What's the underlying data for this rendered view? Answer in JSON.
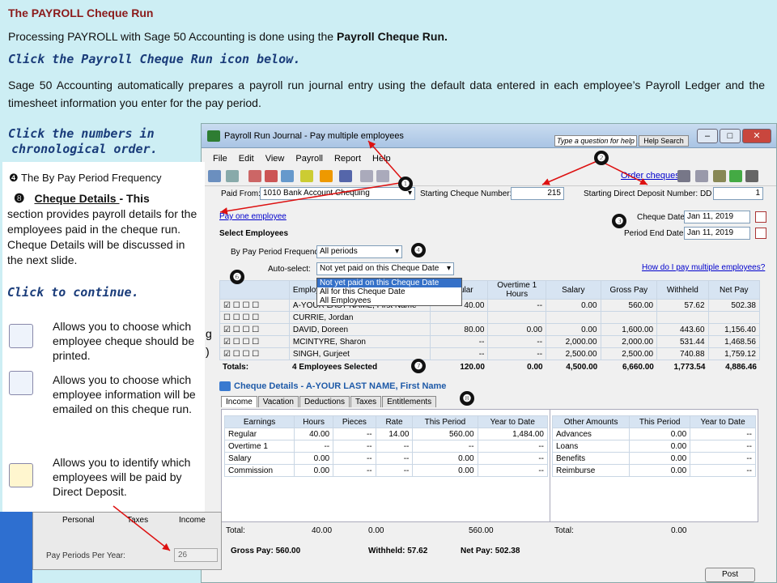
{
  "slide": {
    "title": "The PAYROLL Cheque Run",
    "intro_pre": "Processing PAYROLL with Sage 50 Accounting is done using the ",
    "intro_bold": "Payroll Cheque Run.",
    "click_icon": "Click the Payroll Cheque Run icon below.",
    "description": "Sage 50 Accounting automatically prepares a payroll run journal entry using the default data entered in each employee’s Payroll Ledger and the timesheet information you enter for the pay period.",
    "click_numbers_1": "Click the numbers in",
    "click_numbers_2": "chronological order."
  },
  "overlay": {
    "item4": "❹ The By Pay Period Frequency",
    "item8_num": "❽",
    "item8_title": "Cheque Details ",
    "item8_dash": " - This",
    "item8_text": "section provides payroll details for the employees paid in the cheque run. Cheque Details will be discussed in the next slide.",
    "click_continue": "Click to continue.",
    "legend": [
      {
        "icon": "print-cheque-icon",
        "text": "Allows you to choose which employee cheque should be printed."
      },
      {
        "icon": "email-info-icon",
        "text": "Allows you to choose which employee information will be emailed on this cheque run."
      },
      {
        "icon": "direct-deposit-icon",
        "text": "Allows you to identify which employees will be paid by Direct Deposit."
      }
    ],
    "partial_g": "g",
    "partial_paren": ")"
  },
  "inset": {
    "tabs": [
      "Personal",
      "Taxes",
      "Income"
    ],
    "ppy_label": "Pay Periods Per Year:",
    "ppy_value": "26"
  },
  "window": {
    "title": "Payroll Run Journal - Pay multiple employees",
    "help_placeholder": "Type a question for help",
    "help_button": "Help Search",
    "menu": [
      "File",
      "Edit",
      "View",
      "Payroll",
      "Report",
      "Help"
    ],
    "order_cheques": "Order cheques",
    "paid_from_label": "Paid From:",
    "paid_from_value": "1010 Bank Account Chequing",
    "start_cheque_label": "Starting Cheque Number:",
    "start_cheque_value": "215",
    "start_dd_label": "Starting Direct Deposit Number: DD",
    "start_dd_value": "1",
    "pay_one": "Pay one employee",
    "cheque_date_label": "Cheque Date:",
    "cheque_date_value": "Jan 11, 2019",
    "period_end_label": "Period End Date:",
    "period_end_value": "Jan 11, 2019",
    "select_employees": "Select Employees",
    "freq_label": "By Pay Period Frequency:",
    "freq_value": "All periods",
    "autoselect_label": "Auto-select:",
    "autoselect_value": "Not yet paid on this Cheque Date",
    "autoselect_options": [
      "Not yet paid on this Cheque Date",
      "All for this Cheque Date",
      "All Employees"
    ],
    "how_link": "How do I pay multiple employees?",
    "emp_headers": [
      "Employee",
      "Regular",
      "Overtime 1 Hours",
      "Salary",
      "Gross Pay",
      "Withheld",
      "Net Pay"
    ],
    "employees": [
      {
        "name": "A-YOUR LAST NAME, First Name",
        "regular": "40.00",
        "ot": "--",
        "salary": "0.00",
        "gross": "560.00",
        "withheld": "57.62",
        "net": "502.38"
      },
      {
        "name": "CURRIE, Jordan",
        "regular": "",
        "ot": "",
        "salary": "",
        "gross": "",
        "withheld": "",
        "net": ""
      },
      {
        "name": "DAVID, Doreen",
        "regular": "80.00",
        "ot": "0.00",
        "salary": "0.00",
        "gross": "1,600.00",
        "withheld": "443.60",
        "net": "1,156.40"
      },
      {
        "name": "MCINTYRE, Sharon",
        "regular": "--",
        "ot": "--",
        "salary": "2,000.00",
        "gross": "2,000.00",
        "withheld": "531.44",
        "net": "1,468.56"
      },
      {
        "name": "SINGH, Gurjeet",
        "regular": "--",
        "ot": "--",
        "salary": "2,500.00",
        "gross": "2,500.00",
        "withheld": "740.88",
        "net": "1,759.12"
      }
    ],
    "totals": {
      "label": "Totals:",
      "selected": "4 Employees Selected",
      "regular": "120.00",
      "ot": "0.00",
      "salary": "4,500.00",
      "gross": "6,660.00",
      "withheld": "1,773.54",
      "net": "4,886.46"
    },
    "cheque_details_title": "Cheque Details - A-YOUR LAST NAME, First Name",
    "detail_tabs": [
      "Income",
      "Vacation",
      "Deductions",
      "Taxes",
      "Entitlements"
    ],
    "earn_headers": [
      "Earnings",
      "Hours",
      "Pieces",
      "Rate",
      "This Period",
      "Year to Date"
    ],
    "earnings": [
      [
        "Regular",
        "40.00",
        "--",
        "14.00",
        "560.00",
        "1,484.00"
      ],
      [
        "Overtime 1",
        "--",
        "--",
        "--",
        "--",
        "--"
      ],
      [
        "Salary",
        "0.00",
        "--",
        "--",
        "0.00",
        "--"
      ],
      [
        "Commission",
        "0.00",
        "--",
        "--",
        "0.00",
        "--"
      ]
    ],
    "other_headers": [
      "Other Amounts",
      "This Period",
      "Year to Date"
    ],
    "other": [
      [
        "Advances",
        "0.00",
        "--"
      ],
      [
        "Loans",
        "0.00",
        "--"
      ],
      [
        "Benefits",
        "0.00",
        "--"
      ],
      [
        "Reimburse",
        "0.00",
        "--"
      ]
    ],
    "bottom_total_label": "Total:",
    "bottom_total_hours": "40.00",
    "bottom_total_pieces": "0.00",
    "bottom_total_period": "560.00",
    "bottom_total2_label": "Total:",
    "bottom_total2_value": "0.00",
    "gross_pay": "Gross Pay: 560.00",
    "withheld": "Withheld: 57.62",
    "net_pay": "Net Pay: 502.38",
    "post": "Post"
  },
  "callouts": [
    "❶",
    "❷",
    "❸",
    "❹",
    "❺",
    "❻",
    "❼",
    "❽"
  ]
}
